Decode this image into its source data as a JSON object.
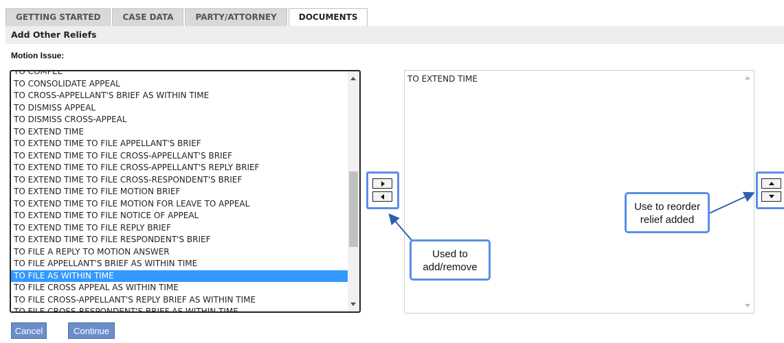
{
  "tabs": [
    {
      "label": "GETTING STARTED"
    },
    {
      "label": "CASE DATA"
    },
    {
      "label": "PARTY/ATTORNEY"
    },
    {
      "label": "DOCUMENTS"
    }
  ],
  "header": {
    "title": "Add Other Reliefs"
  },
  "motion_issue_label": "Motion Issue:",
  "available_options": [
    "TO COMPEL",
    "TO CONSOLIDATE APPEAL",
    "TO CROSS-APPELLANT'S BRIEF AS WITHIN TIME",
    "TO DISMISS APPEAL",
    "TO DISMISS CROSS-APPEAL",
    "TO EXTEND TIME",
    "TO EXTEND TIME TO FILE APPELLANT'S BRIEF",
    "TO EXTEND TIME TO FILE CROSS-APPELLANT'S BRIEF",
    "TO EXTEND TIME TO FILE CROSS-APPELLANT'S REPLY BRIEF",
    "TO EXTEND TIME TO FILE CROSS-RESPONDENT'S BRIEF",
    "TO EXTEND TIME TO FILE MOTION BRIEF",
    "TO EXTEND TIME TO FILE MOTION FOR LEAVE TO APPEAL",
    "TO EXTEND TIME TO FILE NOTICE OF APPEAL",
    "TO EXTEND TIME TO FILE REPLY BRIEF",
    "TO EXTEND TIME TO FILE RESPONDENT'S BRIEF",
    "TO FILE A REPLY TO MOTION ANSWER",
    "TO FILE APPELLANT'S BRIEF AS WITHIN TIME",
    "TO FILE AS WITHIN TIME",
    "TO FILE CROSS APPEAL AS WITHIN TIME",
    "TO FILE CROSS-APPELLANT'S REPLY BRIEF AS WITHIN TIME",
    "TO FILE CROSS-RESPONDENT'S BRIEF AS WITHIN TIME"
  ],
  "selected_option": "TO FILE AS WITHIN TIME",
  "added_reliefs": [
    "TO EXTEND TIME"
  ],
  "callouts": {
    "add_remove": [
      "Used to",
      "add/remove"
    ],
    "reorder": [
      "Use to reorder",
      "relief added"
    ]
  },
  "buttons": {
    "cancel": "Cancel",
    "continue": "Continue"
  },
  "colors": {
    "highlight": "#5b8de8",
    "selected_row": "#3399ff",
    "button": "#6b8ec9"
  },
  "icons": {
    "add": "triangle-right-icon",
    "remove": "triangle-left-icon",
    "move_up": "triangle-up-icon",
    "move_down": "triangle-down-icon"
  }
}
